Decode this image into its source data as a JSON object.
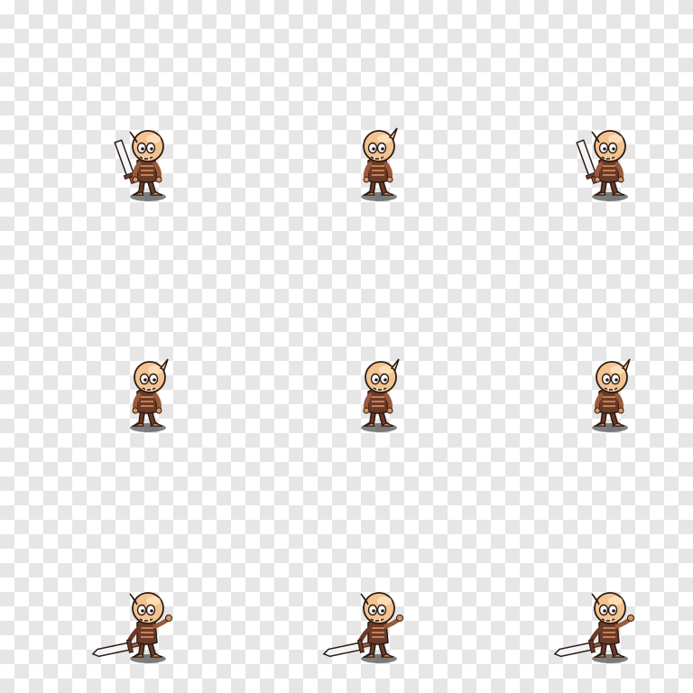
{
  "sheet": {
    "frames": [
      {
        "row": 1,
        "col": 1,
        "pose": "idle",
        "facing": "front",
        "weapon": "sword-raised"
      },
      {
        "row": 1,
        "col": 2,
        "pose": "idle",
        "facing": "front",
        "weapon": "none"
      },
      {
        "row": 1,
        "col": 3,
        "pose": "idle",
        "facing": "front",
        "weapon": "sword-raised"
      },
      {
        "row": 2,
        "col": 1,
        "pose": "walk",
        "facing": "side",
        "weapon": "none"
      },
      {
        "row": 2,
        "col": 2,
        "pose": "walk",
        "facing": "side",
        "weapon": "none"
      },
      {
        "row": 2,
        "col": 3,
        "pose": "walk",
        "facing": "side",
        "weapon": "none"
      },
      {
        "row": 3,
        "col": 1,
        "pose": "attack",
        "facing": "front",
        "weapon": "sword-thrust"
      },
      {
        "row": 3,
        "col": 2,
        "pose": "attack",
        "facing": "front",
        "weapon": "sword-thrust"
      },
      {
        "row": 3,
        "col": 3,
        "pose": "attack",
        "facing": "front",
        "weapon": "sword-thrust"
      }
    ]
  },
  "colors": {
    "skin": "#f2c28f",
    "skin_shade": "#d9955e",
    "armor": "#6b3a28",
    "armor_light": "#9a5a3c",
    "outline": "#2a1a14",
    "blade": "#f4f4f4",
    "shadow": "#555555",
    "checker_light": "#ffffff",
    "checker_dark": "#e6e6e6"
  }
}
